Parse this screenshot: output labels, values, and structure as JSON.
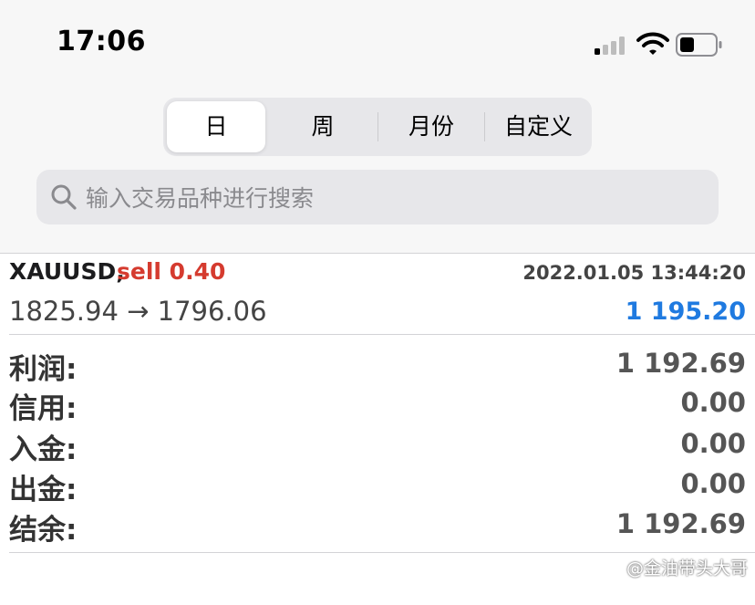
{
  "status_bar": {
    "time": "17:06"
  },
  "period_tabs": [
    {
      "label": "日",
      "active": true
    },
    {
      "label": "周",
      "active": false
    },
    {
      "label": "月份",
      "active": false
    },
    {
      "label": "自定义",
      "active": false
    }
  ],
  "search": {
    "placeholder": "输入交易品种进行搜索",
    "value": ""
  },
  "trade": {
    "symbol": "XAUUSD,",
    "side": "sell 0.40",
    "datetime": "2022.01.05 13:44:20",
    "prices": "1825.94 → 1796.06",
    "profit": "1 195.20"
  },
  "summary": [
    {
      "label": "利润:",
      "value": "1 192.69"
    },
    {
      "label": "信用:",
      "value": "0.00"
    },
    {
      "label": "入金:",
      "value": "0.00"
    },
    {
      "label": "出金:",
      "value": "0.00"
    },
    {
      "label": "结余:",
      "value": "1 192.69"
    }
  ],
  "watermark": "@金油带头大哥",
  "colors": {
    "sell": "#d53b2f",
    "profit": "#1f7ae0"
  }
}
